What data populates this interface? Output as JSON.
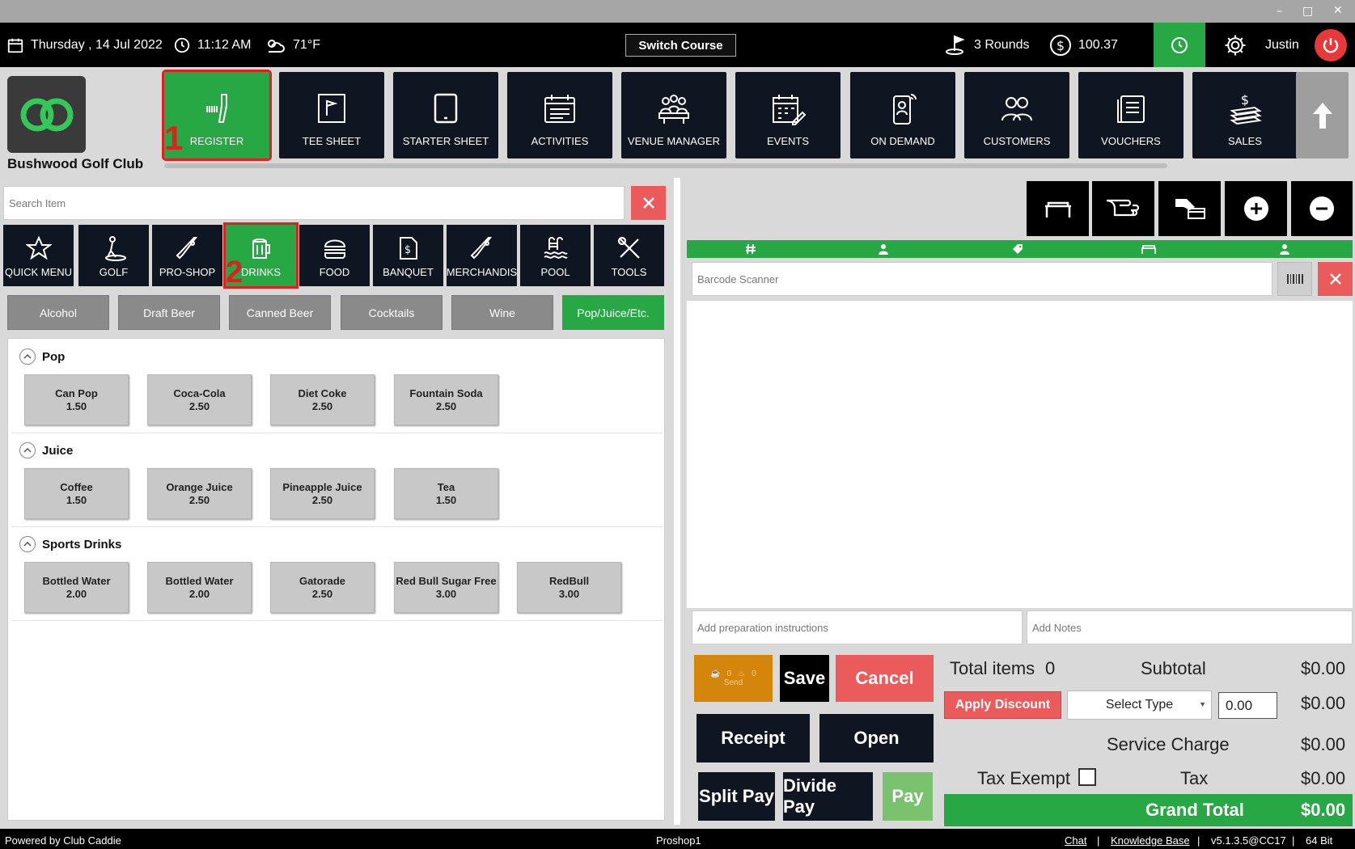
{
  "topbar": {
    "date": "Thursday ,  14 Jul 2022",
    "time": "11:12 AM",
    "weather": "71°F",
    "switch_course": "Switch Course",
    "rounds": "3 Rounds",
    "balance": "100.37",
    "user": "Justin"
  },
  "club": {
    "name": "Bushwood Golf Club"
  },
  "nav": [
    {
      "label": "REGISTER",
      "icon": "barcode-scanner-icon",
      "active": true
    },
    {
      "label": "TEE SHEET",
      "icon": "flag-board-icon"
    },
    {
      "label": "STARTER SHEET",
      "icon": "tablet-icon"
    },
    {
      "label": "ACTIVITIES",
      "icon": "calendar-list-icon"
    },
    {
      "label": "VENUE MANAGER",
      "icon": "meeting-icon"
    },
    {
      "label": "EVENTS",
      "icon": "calendar-edit-icon"
    },
    {
      "label": "ON DEMAND",
      "icon": "phone-user-icon"
    },
    {
      "label": "CUSTOMERS",
      "icon": "people-icon"
    },
    {
      "label": "VOUCHERS",
      "icon": "voucher-icon"
    },
    {
      "label": "SALES",
      "icon": "money-stack-icon"
    }
  ],
  "steps": {
    "one": "1",
    "two": "2"
  },
  "search": {
    "placeholder": "Search Item"
  },
  "categories": [
    {
      "label": "QUICK MENU",
      "icon": "star-icon"
    },
    {
      "label": "GOLF",
      "icon": "golfer-icon"
    },
    {
      "label": "PRO-SHOP",
      "icon": "club-icon"
    },
    {
      "label": "DRINKS",
      "icon": "beer-mug-icon",
      "active": true
    },
    {
      "label": "FOOD",
      "icon": "burger-icon"
    },
    {
      "label": "BANQUET",
      "icon": "invoice-icon"
    },
    {
      "label": "MERCHANDIS",
      "icon": "club-tag-icon"
    },
    {
      "label": "POOL",
      "icon": "pool-icon"
    },
    {
      "label": "TOOLS",
      "icon": "tools-icon"
    }
  ],
  "subcategories": [
    {
      "label": "Alcohol"
    },
    {
      "label": "Draft Beer"
    },
    {
      "label": "Canned Beer"
    },
    {
      "label": "Cocktails"
    },
    {
      "label": "Wine"
    },
    {
      "label": "Pop/Juice/Etc.",
      "active": true
    }
  ],
  "groups": [
    {
      "name": "Pop",
      "items": [
        {
          "name": "Can Pop",
          "price": "1.50"
        },
        {
          "name": "Coca-Cola",
          "price": "2.50"
        },
        {
          "name": "Diet Coke",
          "price": "2.50"
        },
        {
          "name": "Fountain Soda",
          "price": "2.50"
        }
      ]
    },
    {
      "name": "Juice",
      "items": [
        {
          "name": "Coffee",
          "price": "1.50"
        },
        {
          "name": "Orange Juice",
          "price": "2.50"
        },
        {
          "name": "Pineapple Juice",
          "price": "2.50"
        },
        {
          "name": "Tea",
          "price": "1.50"
        }
      ]
    },
    {
      "name": "Sports Drinks",
      "items": [
        {
          "name": "Bottled Water",
          "price": "2.00"
        },
        {
          "name": "Bottled Water",
          "price": "2.00"
        },
        {
          "name": "Gatorade",
          "price": "2.50"
        },
        {
          "name": "Red Bull Sugar Free",
          "price": "3.00"
        },
        {
          "name": "RedBull",
          "price": "3.00"
        }
      ]
    }
  ],
  "cart": {
    "barcode_placeholder": "Barcode Scanner",
    "prep_placeholder": "Add preparation instructions",
    "notes_placeholder": "Add Notes",
    "columns_icons": [
      "hash-icon",
      "user-icon",
      "tag-icon",
      "table-icon",
      "person-icon"
    ]
  },
  "actions": {
    "send": "Send",
    "send_count_a": "0",
    "send_count_b": "0",
    "save": "Save",
    "cancel": "Cancel",
    "receipt": "Receipt",
    "open": "Open",
    "split_pay": "Split Pay",
    "divide_pay": "Divide Pay",
    "pay": "Pay"
  },
  "summary": {
    "total_items_label": "Total items",
    "total_items": "0",
    "subtotal_label": "Subtotal",
    "subtotal": "$0.00",
    "apply_discount": "Apply Discount",
    "select_type": "Select Type",
    "discount_value": "0.00",
    "discount_amount": "$0.00",
    "service_charge_label": "Service Charge",
    "service_charge": "$0.00",
    "tax_exempt_label": "Tax Exempt",
    "tax_label": "Tax",
    "tax": "$0.00",
    "grand_total_label": "Grand Total",
    "grand_total": "$0.00"
  },
  "footer": {
    "powered": "Powered by Club Caddie",
    "station": "Proshop1",
    "chat": "Chat",
    "kb": "Knowledge Base",
    "version": "v5.1.3.5@CC17",
    "bits": "64 Bit",
    "sep": "|"
  },
  "colors": {
    "accent": "#27a844",
    "danger": "#ec5b5b",
    "nav_bg": "#101621",
    "send": "#d4850b"
  }
}
